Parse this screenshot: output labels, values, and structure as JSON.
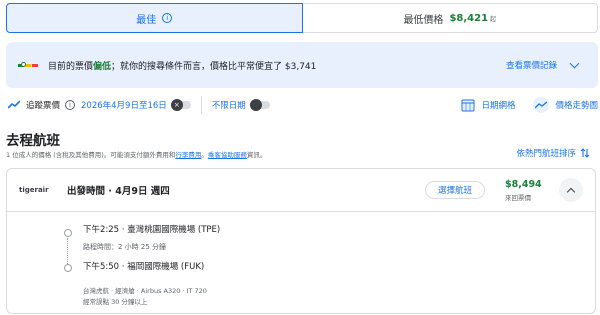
{
  "tabs": {
    "best": "最佳",
    "cheapest_label": "最低價格",
    "cheapest_price": "$8,421",
    "cheapest_sub": "起"
  },
  "banner": {
    "prefix": "目前的票價",
    "level": "偏低",
    "suffix": "；就你的搜尋條件而言，價格比平常便宜了 $3,741",
    "link": "查看票價記錄"
  },
  "tracking": {
    "label": "追蹤票價",
    "dates": "2026年4月9日至16日",
    "any_dates": "不限日期",
    "date_grid": "日期網格",
    "price_graph": "價格走勢圖"
  },
  "section": {
    "title": "去程航班",
    "sub_prefix": "1 位成人的價格 (含稅及其他費用)。可能須支付額外費用和",
    "sub_link1": "行李費用",
    "sub_mid": "。",
    "sub_link2": "乘客協助服務",
    "sub_suffix": "資訊。",
    "sort": "依熱門航班排序"
  },
  "flight": {
    "airline_logo": "tigerair",
    "departure_heading": "出發時間 · 4月9日 週四",
    "select_label": "選擇航班",
    "price": "$8,494",
    "price_sub": "來回票價",
    "segment_depart": "下午2:25 · 臺灣桃園國際機場 (TPE)",
    "duration": "路程時間：2 小時 25 分鐘",
    "segment_arrive": "下午5:50 · 福岡國際機場 (FUK)",
    "details": "台灣虎航 · 經濟艙 · Airbus A320 · IT 720",
    "delay_note": "經常誤點 30 分鐘以上"
  },
  "colors": {
    "accent": "#1a73e8",
    "price_green": "#188038",
    "banner_bg": "#e8f0fe"
  },
  "icons": [
    "info-icon",
    "price-meter-icon",
    "chevron-down-icon",
    "trend-icon",
    "toggle-icon",
    "calendar-grid-icon",
    "graph-icon",
    "sort-icon",
    "chevron-up-icon"
  ]
}
